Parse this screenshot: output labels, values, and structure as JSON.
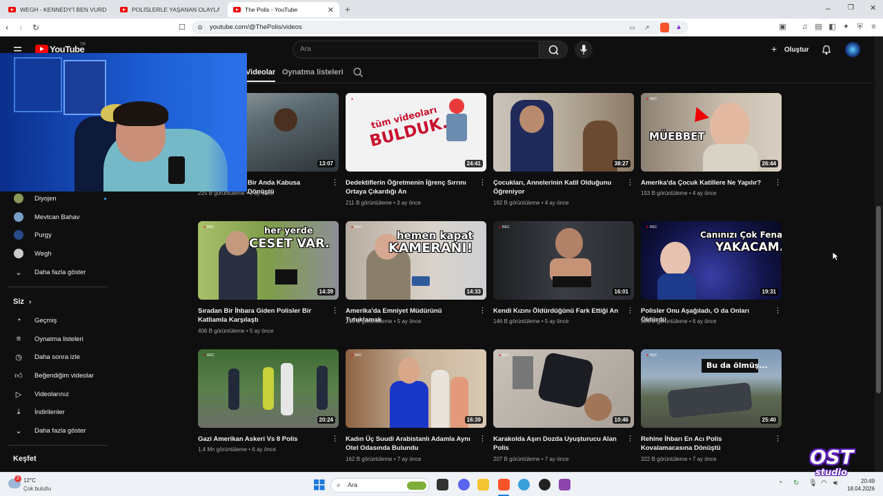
{
  "browser": {
    "tabs": [
      {
        "label": "WEGH - KENNEDY'İ BEN VURDUM (O"
      },
      {
        "label": "POLİSLERLE YAŞANAN OLAYLAR #1"
      },
      {
        "label": "The Polis - YouTube"
      }
    ],
    "url": "youtube.com/@ThePolis/videos"
  },
  "youtube": {
    "logo_text": "YouTube",
    "region": "TR",
    "search_placeholder": "Ara",
    "create_label": "Oluştur",
    "channel_tabs": [
      {
        "label": "Videolar"
      },
      {
        "label": "Oynatma listeleri"
      }
    ],
    "subscriptions": [
      {
        "label": "Diyojen",
        "color": "#8b9a5b"
      },
      {
        "label": "Mevtcan Bahav",
        "color": "#7aa0c8"
      },
      {
        "label": "Purgy",
        "color": "#2a4a8c"
      },
      {
        "label": "Wegh",
        "color": "#cccccc"
      }
    ],
    "show_more_1": "Daha fazla göster",
    "you_section_title": "Siz",
    "you_items": [
      {
        "label": "Geçmiş"
      },
      {
        "label": "Oynatma listeleri"
      },
      {
        "label": "Daha sonra izle"
      },
      {
        "label": "Beğendiğim videolar"
      },
      {
        "label": "Videolarınız"
      },
      {
        "label": "İndirilenler"
      }
    ],
    "show_more_2": "Daha fazla göster",
    "explore_title": "Keşfet",
    "videos": [
      {
        "title": "Bir Anda Kabusa Dönüştü",
        "views": "225 B görüntüleme",
        "age": "3 ay önce",
        "duration": "13:07",
        "overlay": "",
        "progress": 0.0
      },
      {
        "title": "Dedektiflerin Öğretmenin İğrenç Sırrını Ortaya Çıkardığı An",
        "views": "211 B görüntüleme",
        "age": "3 ay önce",
        "duration": "24:41",
        "overlay": "tüm videoları BULDUK.",
        "progress": 0.0
      },
      {
        "title": "Çocukları, Annelerinin Katil Olduğunu Öğreniyor",
        "views": "182 B görüntüleme",
        "age": "4 ay önce",
        "duration": "38:27",
        "overlay": "",
        "progress": 0.0
      },
      {
        "title": "Amerika'da Çocuk Katillere Ne Yapılır?",
        "views": "153 B görüntüleme",
        "age": "4 ay önce",
        "duration": "26:44",
        "overlay": "MÜEBBET",
        "progress": 0.0
      },
      {
        "title": "Sıradan Bir İhbara Giden Polisler Bir Katliamla Karşılaştı",
        "views": "406 B görüntüleme",
        "age": "5 ay önce",
        "duration": "14:39",
        "overlay": "her yerde CESET VAR.",
        "progress": 0.0
      },
      {
        "title": "Amerika'da Emniyet Müdürünü Tutuklamak",
        "views": "216 B görüntüleme",
        "age": "5 ay önce",
        "duration": "14:33",
        "overlay": "hemen kapat KAMERANI!",
        "progress": 0.0
      },
      {
        "title": "Kendi Kızını Öldürdüğünü Fark Ettiği An",
        "views": "146 B görüntüleme",
        "age": "5 ay önce",
        "duration": "16:01",
        "overlay": "",
        "progress": 0.0
      },
      {
        "title": "Polisler Onu Aşağıladı, O da Onları Öldürdü",
        "views": "396 B görüntüleme",
        "age": "6 ay önce",
        "duration": "19:31",
        "overlay": "Canınızı Çok Fena YAKACAM.",
        "progress": 0.0
      },
      {
        "title": "Gazi Amerikan Askeri Vs 8 Polis",
        "views": "1,4 Mn görüntüleme",
        "age": "6 ay önce",
        "duration": "20:24",
        "overlay": "",
        "progress": 0.0
      },
      {
        "title": "Kadın Üç Suudi Arabistanlı Adamla Aynı Otel Odasında Bulundu",
        "views": "162 B görüntüleme",
        "age": "7 ay önce",
        "duration": "16:39",
        "overlay": "",
        "progress": 0.0
      },
      {
        "title": "Karakolda Aşırı Dozda Uyuşturucu Alan Polis",
        "views": "207 B görüntüleme",
        "age": "7 ay önce",
        "duration": "10:46",
        "overlay": "",
        "progress": 0.0
      },
      {
        "title": "Rehine İhbarı En Acı Polis Kovalamacasına Dönüştü",
        "views": "322 B görüntüleme",
        "age": "7 ay önce",
        "duration": "25:40",
        "overlay": "Bu da ölmüş...",
        "progress": 0.0
      }
    ]
  },
  "taskbar": {
    "weather_temp": "12°C",
    "weather_desc": "Çok bulutlu",
    "weather_badge": "2",
    "search_placeholder": "Ara",
    "time": "20:49",
    "date": "18.04.2026"
  },
  "watermark": {
    "line1": "OST",
    "line2": "studio"
  }
}
